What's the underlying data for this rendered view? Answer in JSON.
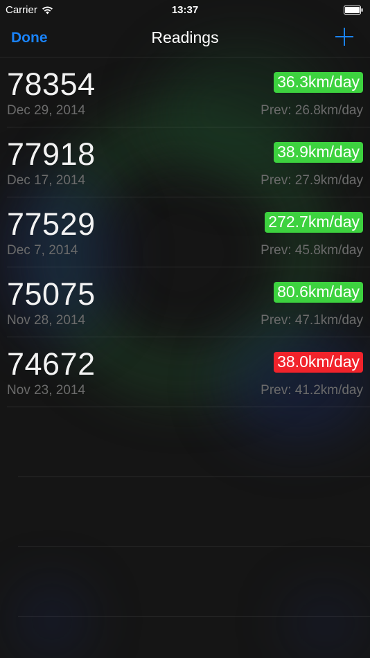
{
  "status_bar": {
    "carrier": "Carrier",
    "time": "13:37"
  },
  "nav": {
    "done_label": "Done",
    "title": "Readings",
    "add_icon": "plus-icon"
  },
  "colors": {
    "accent": "#1a82f7",
    "increase": "#3dd23f",
    "decrease": "#f1232b"
  },
  "readings": [
    {
      "value": "78354",
      "date": "Dec 29, 2014",
      "rate": "36.3km/day",
      "prev": "Prev: 26.8km/day",
      "trend": "up"
    },
    {
      "value": "77918",
      "date": "Dec 17, 2014",
      "rate": "38.9km/day",
      "prev": "Prev: 27.9km/day",
      "trend": "up"
    },
    {
      "value": "77529",
      "date": "Dec 7, 2014",
      "rate": "272.7km/day",
      "prev": "Prev: 45.8km/day",
      "trend": "up"
    },
    {
      "value": "75075",
      "date": "Nov 28, 2014",
      "rate": "80.6km/day",
      "prev": "Prev: 47.1km/day",
      "trend": "up"
    },
    {
      "value": "74672",
      "date": "Nov 23, 2014",
      "rate": "38.0km/day",
      "prev": "Prev: 41.2km/day",
      "trend": "down"
    }
  ]
}
